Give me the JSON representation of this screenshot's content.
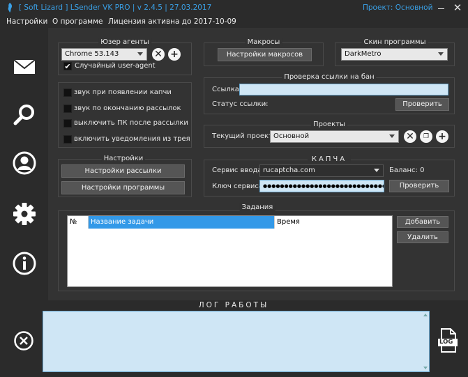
{
  "window": {
    "title": "[ Soft Lizard ] LSender VK PRO | v 2.4.5 | 27.03.2017",
    "project_label": "Проект: Основной",
    "minimize": "minimize",
    "close_glyph": "✕"
  },
  "menu": {
    "settings": "Настройки",
    "about": "О программе",
    "license": "Лицензия активна до 2017-10-09"
  },
  "user_agents": {
    "title": "Юзер агенты",
    "selected": "Chrome 53.143",
    "random_label": "Случайный user-agent",
    "random_checked": true
  },
  "options": {
    "items": [
      "звук при появлении капчи",
      "звук по окончанию рассылок",
      "выключить ПК после рассылки",
      "включить уведомления из трея"
    ]
  },
  "settings_group": {
    "title": "Настройки",
    "mailing_btn": "Настройки рассылки",
    "program_btn": "Настройки программы"
  },
  "macros": {
    "title": "Макросы",
    "btn": "Настройки макросов"
  },
  "skin": {
    "title": "Скин программы",
    "selected": "DarkMetro"
  },
  "ban_check": {
    "title": "Проверка ссылки на бан",
    "link_label": "Ссылка",
    "link_value": "",
    "status_label": "Статус ссылки:",
    "status_value": "-",
    "check_btn": "Проверить"
  },
  "projects": {
    "title": "Проекты",
    "current_label": "Текущий проект",
    "selected": "Основной"
  },
  "captcha": {
    "title": "КАПЧА",
    "service_label": "Сервис ввода",
    "service_selected": "rucaptcha.com",
    "balance": "Баланс: 0",
    "key_label": "Ключ сервиса",
    "key_value": "●●●●●●●●●●●●●●●●●●●●●●●●●●●●●●●●",
    "check_btn": "Проверить"
  },
  "tasks": {
    "title": "Задания",
    "columns": [
      "№",
      "Название задачи",
      "Время"
    ],
    "add_btn": "Добавить",
    "delete_btn": "Удалить"
  },
  "log": {
    "title": "ЛОГ РАБОТЫ",
    "log_icon_text": "LOG"
  },
  "colors": {
    "accent": "#3aa0e6",
    "input_bg": "#cfe6f5",
    "selected_col": "#3399e8"
  }
}
